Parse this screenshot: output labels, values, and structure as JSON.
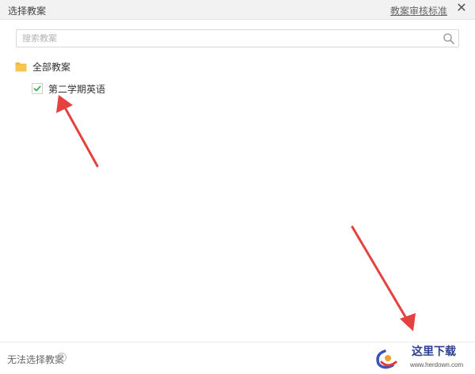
{
  "header": {
    "title": "选择教案",
    "criteria_link": "教案审核标准",
    "close_glyph": "✕"
  },
  "search": {
    "placeholder": "搜索教案",
    "value": ""
  },
  "tree": {
    "root": {
      "label": "全部教案",
      "icon": "folder-icon",
      "color": "#f5b93f"
    },
    "children": [
      {
        "label": "第二学期英语",
        "checked": true,
        "check_color": "#3bb34a"
      }
    ]
  },
  "footer": {
    "status_text": "无法选择教案",
    "help_glyph": "?"
  },
  "watermark": {
    "text": "这里下载",
    "url": "www.herdown.com"
  },
  "colors": {
    "annotation_arrow": "#e5413f",
    "header_bg": "#f2f2f2"
  }
}
